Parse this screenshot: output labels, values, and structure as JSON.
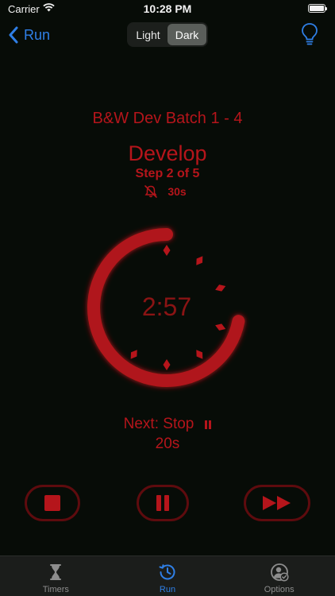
{
  "status_bar": {
    "carrier": "Carrier",
    "time": "10:28 PM"
  },
  "nav": {
    "back_label": "Run",
    "segments": [
      "Light",
      "Dark"
    ],
    "selected_segment": "Dark",
    "right_icon": "lightbulb-icon"
  },
  "run": {
    "batch_title": "B&W Dev Batch 1 - 4",
    "step_name": "Develop",
    "step_count": "Step 2 of 5",
    "alert_interval": "30s",
    "alert_icon": "bell-slash-icon",
    "timer": "2:57",
    "next_label": "Next: Stop",
    "next_time": "20s",
    "progress_remaining_fraction": 0.72
  },
  "controls": [
    {
      "name": "stop",
      "icon": "stop-icon"
    },
    {
      "name": "pause",
      "icon": "pause-icon"
    },
    {
      "name": "skip",
      "icon": "fast-forward-icon"
    }
  ],
  "tabs": [
    {
      "label": "Timers",
      "icon": "hourglass-icon"
    },
    {
      "label": "Run",
      "icon": "history-clock-icon"
    },
    {
      "label": "Options",
      "icon": "person-check-icon"
    }
  ],
  "colors": {
    "accent_red": "#b5151b",
    "ios_blue": "#2f7fe6",
    "background": "#070c07"
  }
}
